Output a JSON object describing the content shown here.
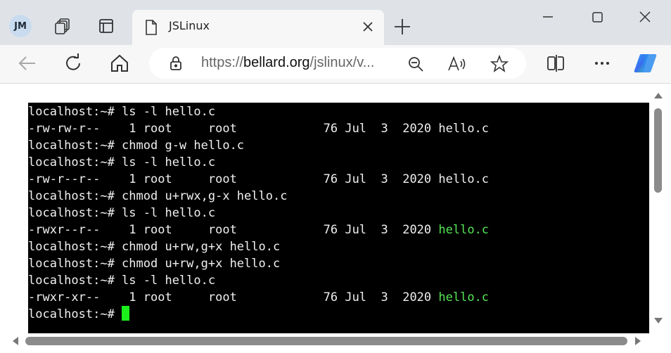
{
  "profile": {
    "initials": "JM"
  },
  "tab": {
    "title": "JSLinux"
  },
  "address": {
    "scheme": "https://",
    "host": "bellard.org",
    "path": "/jslinux/v..."
  },
  "terminal": {
    "lines": [
      {
        "text": "localhost:~# ls -l hello.c"
      },
      {
        "text": "-rw-rw-r--    1 root     root            76 Jul  3  2020 hello.c"
      },
      {
        "text": "localhost:~# chmod g-w hello.c"
      },
      {
        "text": "localhost:~# ls -l hello.c"
      },
      {
        "text": "-rw-r--r--    1 root     root            76 Jul  3  2020 hello.c"
      },
      {
        "text": "localhost:~# chmod u+rwx,g-x hello.c"
      },
      {
        "text": "localhost:~# ls -l hello.c"
      },
      {
        "text": "-rwxr--r--    1 root     root            76 Jul  3  2020 ",
        "green": "hello.c"
      },
      {
        "text": "localhost:~# chmod u+rw,g+x hello.c"
      },
      {
        "text": "localhost:~# chmod u+rw,g+x hello.c"
      },
      {
        "text": "localhost:~# ls -l hello.c"
      },
      {
        "text": "-rwxr-xr--    1 root     root            76 Jul  3  2020 ",
        "green": "hello.c"
      },
      {
        "text": "localhost:~# "
      }
    ]
  },
  "colors": {
    "terminal_bg": "#000000",
    "terminal_fg": "#f0f0f0",
    "exec_green": "#55e655",
    "cursor": "#1cf01c"
  }
}
